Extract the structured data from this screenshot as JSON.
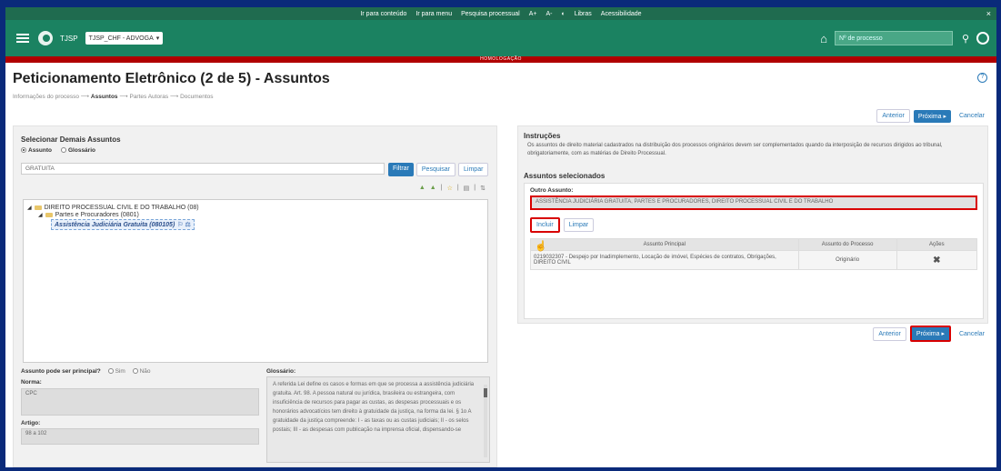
{
  "accessibility_bar": {
    "items": [
      "Ir para conteúdo",
      "Ir para menu",
      "Pesquisa processual",
      "A+",
      "A-",
      "◐",
      "Libras",
      "Acessibilidade"
    ],
    "close": "×"
  },
  "header": {
    "brand": "TJSP",
    "profile_select": "TJSP_CHF - ADVOGA",
    "search_placeholder": "Nº de processo",
    "environment_banner": "HOMOLOGAÇÃO"
  },
  "page": {
    "title": "Peticionamento Eletrônico (2 de 5) - Assuntos",
    "breadcrumb": [
      "Informações do processo",
      "Assuntos",
      "Partes Autoras",
      "Documentos"
    ],
    "breadcrumb_active_index": 1
  },
  "nav": {
    "previous": "Anterior",
    "next": "Próxima ▸",
    "cancel": "Cancelar"
  },
  "left_panel": {
    "title": "Selecionar Demais Assuntos",
    "radio_options": [
      "Assunto",
      "Glossário"
    ],
    "radio_selected": "Assunto",
    "search_value": "GRATUITA",
    "filter_button": "Filtrar",
    "search_button": "Pesquisar",
    "clear_button": "Limpar",
    "tree": {
      "root": "DIREITO PROCESSUAL CIVIL E DO TRABALHO (08)",
      "child": "Partes e Procuradores (0801)",
      "leaf": "Assistência Judiciária Gratuita (080105)"
    },
    "principal_question": "Assunto pode ser principal?",
    "principal_options": [
      "Sim",
      "Não"
    ],
    "norma_label": "Norma:",
    "norma_value": "CPC",
    "artigo_label": "Artigo:",
    "artigo_value": "98 a 102",
    "glossario_label": "Glossário:",
    "glossario_text": "A referida Lei define os casos e formas em que se processa a assistência judiciária gratuita. Art. 98. A pessoa natural ou jurídica, brasileira ou estrangeira, com insuficiência de recursos para pagar as custas, as despesas processuais e os honorários advocatícios tem direito à gratuidade da justiça, na forma da lei. § 1o A gratuidade da justiça compreende: I - as taxas ou as custas judiciais; II - os selos postais; III - as despesas com publicação na imprensa oficial, dispensando-se"
  },
  "right_panel": {
    "instructions_title": "Instruções",
    "instructions_text": "Os assuntos de direito material cadastrados na distribuição dos processos originários devem ser complementados quando da interposição de recursos dirigidos ao tribunal, obrigatoriamente, com as matérias de Direito Processual.",
    "selected_title": "Assuntos selecionados",
    "outro_label": "Outro Assunto:",
    "outro_value": "ASSISTÊNCIA JUDICIÁRIA GRATUITA, PARTES E PROCURADORES, DIREITO PROCESSUAL CIVIL E DO TRABALHO",
    "include_button": "Incluir",
    "clear_button": "Limpar",
    "table": {
      "headers": [
        "Assunto Principal",
        "Assunto do Processo",
        "Ações"
      ],
      "rows": [
        {
          "principal": "0219032307 - Despejo por Inadimplemento, Locação de imóvel, Espécies de contratos, Obrigações, DIREITO CIVIL",
          "processo": "Originário",
          "action": "✖"
        }
      ]
    }
  }
}
